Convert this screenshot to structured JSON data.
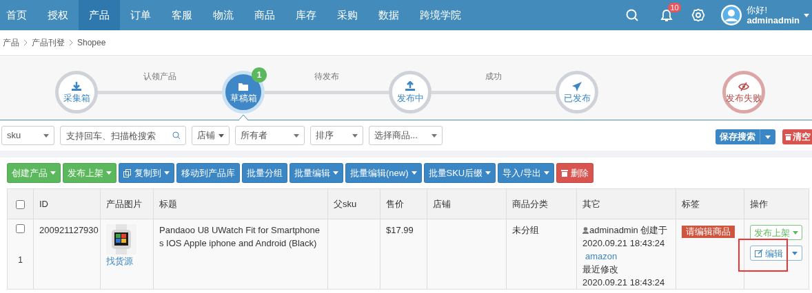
{
  "nav": {
    "items": [
      {
        "label": "首页",
        "selected": false
      },
      {
        "label": "授权",
        "selected": false
      },
      {
        "label": "产品",
        "selected": true
      },
      {
        "label": "订单",
        "selected": false
      },
      {
        "label": "客服",
        "selected": false
      },
      {
        "label": "物流",
        "selected": false
      },
      {
        "label": "商品",
        "selected": false
      },
      {
        "label": "库存",
        "selected": false
      },
      {
        "label": "采购",
        "selected": false
      },
      {
        "label": "数据",
        "selected": false
      },
      {
        "label": "跨境学院",
        "selected": false
      }
    ],
    "notification_count": "10",
    "user": {
      "greeting": "你好!",
      "name": "adminadmin"
    }
  },
  "breadcrumb": [
    "产品",
    "产品刊登",
    "Shopee"
  ],
  "steps": [
    {
      "label": "采集箱",
      "kind": "download",
      "selected": false
    },
    {
      "label": "草稿箱",
      "kind": "folder",
      "selected": true,
      "badge": "1"
    },
    {
      "label": "发布中",
      "kind": "upload",
      "selected": false
    },
    {
      "label": "已发布",
      "kind": "plane",
      "selected": false
    },
    {
      "label": "发布失败",
      "kind": "failed",
      "selected": false
    }
  ],
  "step_connectors": [
    "认领产品",
    "待发布",
    "成功"
  ],
  "filters": [
    {
      "kind": "select",
      "value": "sku"
    },
    {
      "kind": "search",
      "placeholder": "支持回车、扫描枪搜索"
    },
    {
      "kind": "dropdown",
      "value": "店铺"
    },
    {
      "kind": "select",
      "value": "所有者"
    },
    {
      "kind": "select",
      "value": "排序"
    },
    {
      "kind": "select",
      "value": "选择商品..."
    }
  ],
  "save_search": "保存搜索",
  "clear": "清空",
  "toolbar": [
    {
      "label": "创建产品",
      "kind": "plain",
      "color": "#5cb85c",
      "caret": true
    },
    {
      "label": "发布上架",
      "kind": "plain",
      "color": "#5cb85c",
      "caret": true
    },
    {
      "label": "复制到",
      "kind": "copy",
      "color": "#3b86c4",
      "caret": true
    },
    {
      "label": "移动到产品库",
      "kind": "plain",
      "color": "#3b86c4",
      "caret": false
    },
    {
      "label": "批量分组",
      "kind": "plain",
      "color": "#3b86c4",
      "caret": false
    },
    {
      "label": "批量编辑",
      "kind": "plain",
      "color": "#3b86c4",
      "caret": true
    },
    {
      "label": "批量编辑(new)",
      "kind": "plain",
      "color": "#3b86c4",
      "caret": true
    },
    {
      "label": "批量SKU后缀",
      "kind": "plain",
      "color": "#3b86c4",
      "caret": true
    },
    {
      "label": "导入/导出",
      "kind": "plain",
      "color": "#3b86c4",
      "caret": true
    },
    {
      "label": "删除",
      "kind": "delete",
      "color": "#d9534f",
      "caret": false
    }
  ],
  "table": {
    "columns": [
      "ID",
      "产品图片",
      "标题",
      "父sku",
      "售价",
      "店铺",
      "商品分类",
      "其它",
      "标签",
      "操作"
    ],
    "header_checked": false,
    "rows": [
      {
        "checked": false,
        "index": "1",
        "id": "200921127930",
        "source_link": "找货源",
        "title": "Pandaoo U8 UWatch Fit for Smartphones IOS Apple iphone and Android (Black)",
        "price": "$17.99",
        "category": "未分组",
        "other": {
          "user": "adminadmin",
          "created_label": "创建于",
          "created": "2020.09.21 18:43:24",
          "source": "amazon",
          "modified_label": "最近修改",
          "modified": "2020.09.21 18:43:24"
        },
        "tag": "请编辑商品",
        "publish": "发布上架",
        "edit": "编辑",
        "highlighted": true
      }
    ]
  }
}
